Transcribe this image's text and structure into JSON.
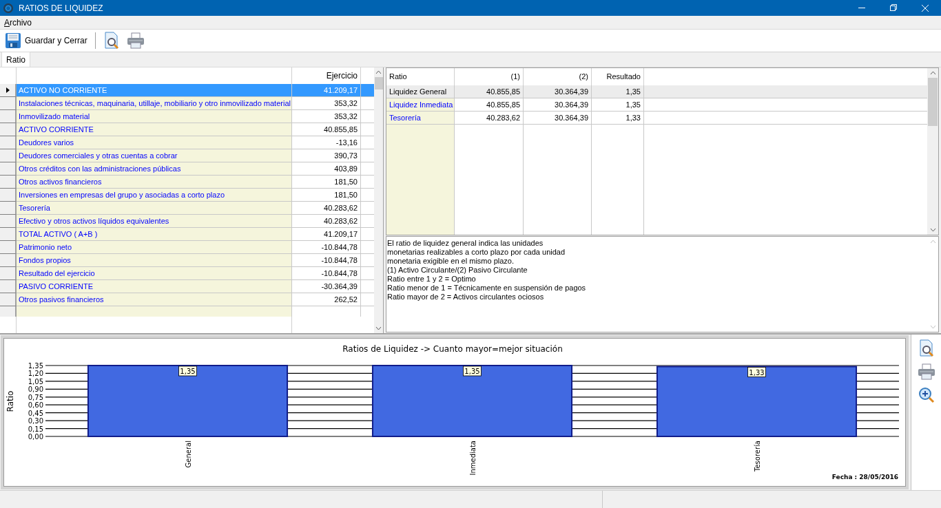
{
  "window": {
    "title": "RATIOS DE LIQUIDEZ"
  },
  "menu": [
    {
      "label": "Archivo"
    }
  ],
  "toolbar": [
    {
      "kind": "save",
      "label": "Guardar y Cerrar"
    },
    {
      "kind": "preview"
    },
    {
      "kind": "print"
    }
  ],
  "tabs": [
    {
      "label": "Ratio",
      "selected": true
    }
  ],
  "accounts": {
    "value_column": "Ejercicio",
    "rows": [
      {
        "name": "ACTIVO NO CORRIENTE",
        "value": "41.209,17",
        "selected": true
      },
      {
        "name": "Instalaciones técnicas, maquinaria, utillaje, mobiliario y otro inmovilizado material",
        "value": "353,32",
        "selected": false
      },
      {
        "name": "Inmovilizado material",
        "value": "353,32",
        "selected": false
      },
      {
        "name": "ACTIVO CORRIENTE",
        "value": "40.855,85",
        "selected": false
      },
      {
        "name": "Deudores varios",
        "value": "-13,16",
        "selected": false
      },
      {
        "name": "Deudores comerciales y otras cuentas a cobrar",
        "value": "390,73",
        "selected": false
      },
      {
        "name": "Otros créditos con las administraciones públicas",
        "value": "403,89",
        "selected": false
      },
      {
        "name": "Otros activos financieros",
        "value": "181,50",
        "selected": false
      },
      {
        "name": "Inversiones en empresas del grupo y asociadas a corto plazo",
        "value": "181,50",
        "selected": false
      },
      {
        "name": "Tesorería",
        "value": "40.283,62",
        "selected": false
      },
      {
        "name": "Efectivo y otros activos líquidos equivalentes",
        "value": "40.283,62",
        "selected": false
      },
      {
        "name": "TOTAL ACTIVO ( A+B )",
        "value": "41.209,17",
        "selected": false
      },
      {
        "name": "Patrimonio neto",
        "value": "-10.844,78",
        "selected": false
      },
      {
        "name": "Fondos propios",
        "value": "-10.844,78",
        "selected": false
      },
      {
        "name": "Resultado del ejercicio",
        "value": "-10.844,78",
        "selected": false
      },
      {
        "name": "PASIVO CORRIENTE",
        "value": "-30.364,39",
        "selected": false
      },
      {
        "name": "Otros pasivos financieros",
        "value": "262,52",
        "selected": false
      }
    ]
  },
  "ratios": {
    "columns": [
      "Ratio",
      "(1)",
      "(2)",
      "Resultado"
    ],
    "rows": [
      {
        "ratio": "Liquidez General",
        "v1": "40.855,85",
        "v2": "30.364,39",
        "result": "1,35",
        "selected": true
      },
      {
        "ratio": "Liquidez Inmediata",
        "v1": "40.855,85",
        "v2": "30.364,39",
        "result": "1,35",
        "selected": false
      },
      {
        "ratio": "Tesorería",
        "v1": "40.283,62",
        "v2": "30.364,39",
        "result": "1,33",
        "selected": false
      }
    ]
  },
  "description": [
    "El ratio de liquidez general indica las unidades",
    "monetarias realizables a corto plazo por cada unidad",
    "monetaria exigible en el mismo plazo.",
    "(1) Activo Circulante/(2) Pasivo Circulante",
    "Ratio entre 1 y 2 = Optimo",
    "Ratio menor de 1 = Técnicamente en suspensión de pagos",
    "Ratio mayor de 2 = Activos circulantes ociosos"
  ],
  "chart": {
    "date": "Fecha : 28/05/2016",
    "chart_data": {
      "type": "bar",
      "title": "Ratios de Liquidez -> Cuanto mayor=mejor situación",
      "ylabel": "Ratio",
      "categories": [
        "General",
        "Inmediata",
        "Tesorería"
      ],
      "values": [
        1.35,
        1.35,
        1.33
      ],
      "grid": true,
      "ylim": [
        0,
        1.35
      ],
      "yticks": [
        {
          "value": 0,
          "label": "0,00"
        },
        {
          "value": 0.15,
          "label": "0,15"
        },
        {
          "value": 0.3,
          "label": "0,30"
        },
        {
          "value": 0.45,
          "label": "0,45"
        },
        {
          "value": 0.6,
          "label": "0,60"
        },
        {
          "value": 0.75,
          "label": "0,75"
        },
        {
          "value": 0.9,
          "label": "0,90"
        },
        {
          "value": 1.05,
          "label": "1,05"
        },
        {
          "value": 1.2,
          "label": "1,20"
        },
        {
          "value": 1.35,
          "label": "1,35"
        }
      ],
      "value_labels": [
        "1,35",
        "1,35",
        "1,33"
      ]
    }
  },
  "chart_tools": [
    {
      "kind": "preview"
    },
    {
      "kind": "print"
    },
    {
      "kind": "zoom"
    }
  ]
}
